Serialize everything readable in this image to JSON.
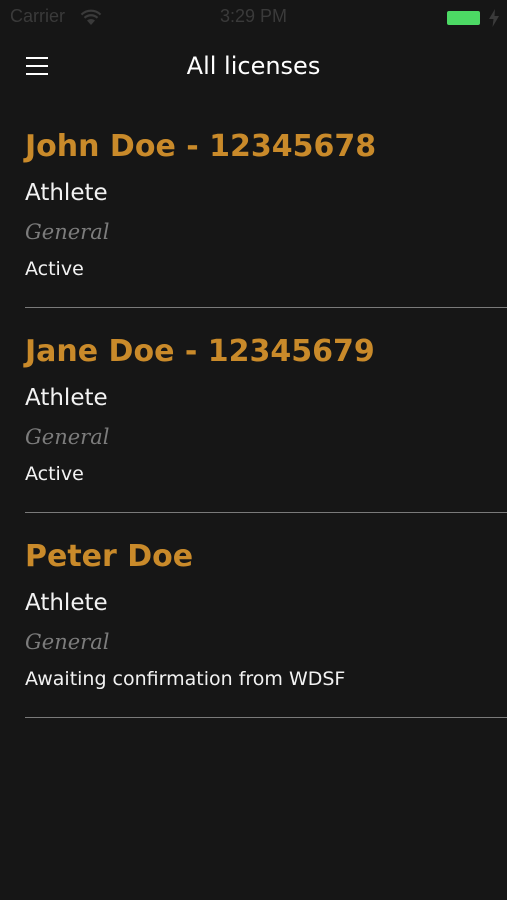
{
  "status_bar": {
    "carrier": "Carrier",
    "time": "3:29 PM",
    "wifi_icon": "wifi-icon",
    "battery_icon": "battery-icon",
    "battery_level": 1.0,
    "battery_color": "#4cd964",
    "charge_icon": "charging-bolt-icon"
  },
  "nav": {
    "menu_icon": "hamburger-menu-icon",
    "title": "All licenses"
  },
  "colors": {
    "background": "#161616",
    "name_accent": "#c98a2a",
    "category": "#7c7c7c",
    "divider": "#7a7a7a"
  },
  "licenses": [
    {
      "name": "John Doe - 12345678",
      "role": "Athlete",
      "category": "General",
      "status": "Active"
    },
    {
      "name": "Jane Doe - 12345679",
      "role": "Athlete",
      "category": "General",
      "status": "Active"
    },
    {
      "name": "Peter Doe",
      "role": "Athlete",
      "category": "General",
      "status": "Awaiting confirmation from WDSF"
    }
  ]
}
